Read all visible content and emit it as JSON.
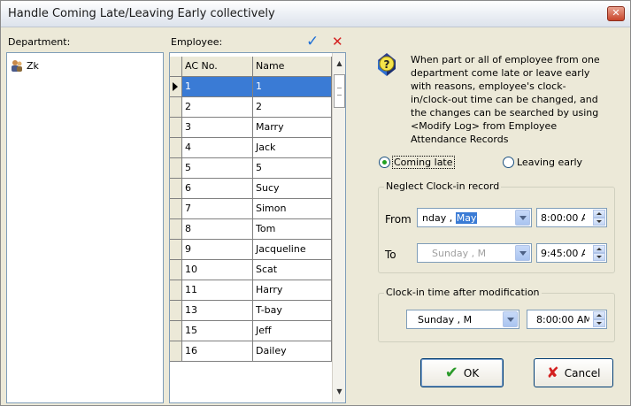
{
  "window": {
    "title": "Handle Coming Late/Leaving Early collectively",
    "close_glyph": "✕"
  },
  "department": {
    "label": "Department:",
    "items": [
      {
        "label": "Zk",
        "icon": "person-group-icon"
      }
    ]
  },
  "employee": {
    "label": "Employee:",
    "check_glyph": "✓",
    "uncheck_glyph": "✕",
    "columns": [
      "AC No.",
      "Name"
    ],
    "rows": [
      {
        "ac": "1",
        "name": "1"
      },
      {
        "ac": "2",
        "name": "2"
      },
      {
        "ac": "3",
        "name": "Marry"
      },
      {
        "ac": "4",
        "name": "Jack"
      },
      {
        "ac": "5",
        "name": "5"
      },
      {
        "ac": "6",
        "name": "Sucy"
      },
      {
        "ac": "7",
        "name": "Simon"
      },
      {
        "ac": "8",
        "name": "Tom"
      },
      {
        "ac": "9",
        "name": "Jacqueline"
      },
      {
        "ac": "10",
        "name": "Scat"
      },
      {
        "ac": "11",
        "name": "Harry"
      },
      {
        "ac": "13",
        "name": "T-bay"
      },
      {
        "ac": "15",
        "name": "Jeff"
      },
      {
        "ac": "16",
        "name": "Dailey"
      }
    ],
    "selected_index": 0
  },
  "info": {
    "text": "When part or all of employee from one department come late or leave early with reasons, employee's clock-in/clock-out time can be changed, and the changes can be searched by using <Modify Log> from Employee Attendance Records"
  },
  "mode": {
    "coming_late": "Coming late",
    "leaving_early": "Leaving early",
    "selected": "coming_late"
  },
  "neglect": {
    "title": "Neglect Clock-in record",
    "from_label": "From",
    "from_date_pre": "nday  ,  ",
    "from_date_sel": "May",
    "from_time": "8:00:00 A",
    "to_label": "To",
    "to_date": "Sunday  ,   M",
    "to_time": "9:45:00 A"
  },
  "modified": {
    "title": "Clock-in time after modification",
    "date": "Sunday  ,    M",
    "time": "8:00:00 AM"
  },
  "buttons": {
    "ok": "OK",
    "cancel": "Cancel"
  },
  "colors": {
    "selection": "#3a7bd5",
    "check": "#1e6fd6",
    "cancel_x": "#d42020",
    "ok_check": "#2a9a2a"
  }
}
